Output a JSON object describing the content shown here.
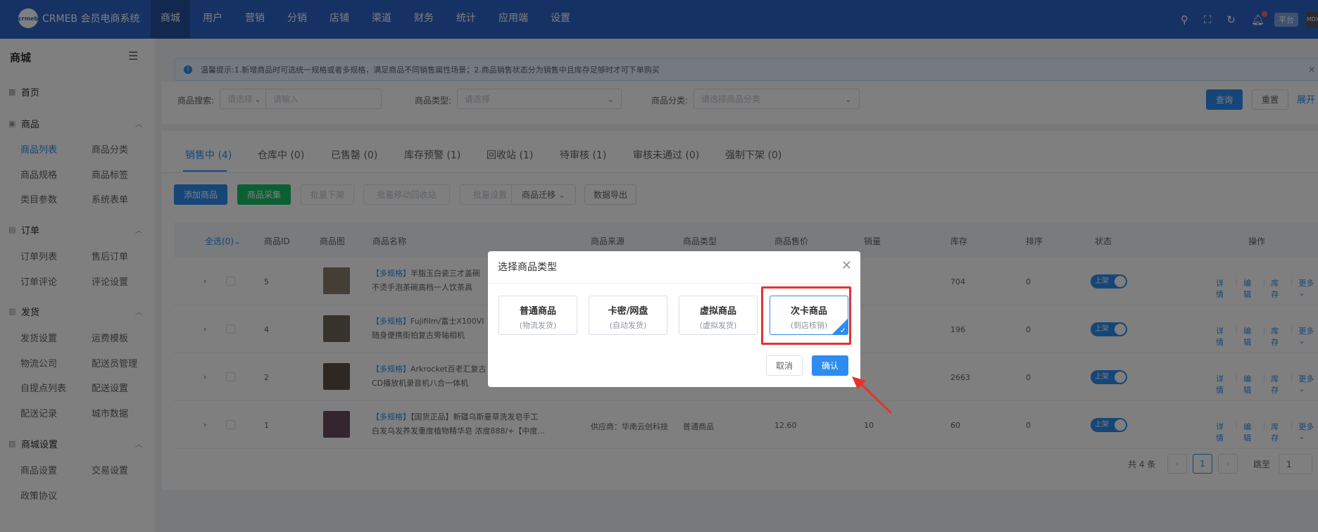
{
  "header": {
    "logo_text": "CRMEB 会员电商系统",
    "logo_mark": "crmeb",
    "nav": [
      "商城",
      "用户",
      "营销",
      "分销",
      "店铺",
      "渠道",
      "财务",
      "统计",
      "应用端",
      "设置"
    ],
    "active_nav": "商城",
    "icons": [
      "search-icon",
      "fullscreen-icon",
      "refresh-icon",
      "bell-icon"
    ],
    "platform_tag": "平台",
    "avatar_text": "MDX"
  },
  "sidebar": {
    "title": "商城",
    "groups": [
      {
        "label": "首页",
        "icon": "home-icon",
        "items": []
      },
      {
        "label": "商品",
        "icon": "goods-icon",
        "items": [
          "商品列表",
          "商品分类",
          "商品规格",
          "商品标签",
          "类目参数",
          "系统表单"
        ]
      },
      {
        "label": "订单",
        "icon": "cart-icon",
        "items": [
          "订单列表",
          "售后订单",
          "订单评论",
          "评论设置"
        ]
      },
      {
        "label": "发货",
        "icon": "truck-icon",
        "items": [
          "发货设置",
          "运费模板",
          "物流公司",
          "配送员管理",
          "自提点列表",
          "配送设置",
          "配送记录",
          "城市数据"
        ]
      },
      {
        "label": "商城设置",
        "icon": "shop-settings-icon",
        "items": [
          "商品设置",
          "交易设置",
          "政策协议"
        ]
      }
    ],
    "active_item": "商品列表"
  },
  "tip": {
    "text": "温馨提示:1.新增商品时可选统一规格或者多规格，满足商品不同销售属性场景；2.商品销售状态分为销售中且库存足够时才可下单购买"
  },
  "filters": {
    "search_label": "商品搜索:",
    "search_select_placeholder": "请选择",
    "search_input_placeholder": "请输入",
    "type_label": "商品类型:",
    "type_placeholder": "请选择",
    "category_label": "商品分类:",
    "category_placeholder": "请选择商品分类",
    "query_button": "查询",
    "reset_button": "重置",
    "expand_link": "展开"
  },
  "tabs": [
    "销售中 (4)",
    "仓库中 (0)",
    "已售罄 (0)",
    "库存预警 (1)",
    "回收站 (1)",
    "待审核 (1)",
    "审核未通过 (0)",
    "强制下架 (0)"
  ],
  "toolbar": {
    "add": "添加商品",
    "collect": "商品采集",
    "batch_off": "批量下架",
    "batch_recycle": "批量移动回收站",
    "batch_settings": "批量设置",
    "migrate": "商品迁移",
    "export": "数据导出"
  },
  "table": {
    "columns": [
      "全选(0)",
      "商品ID",
      "商品图",
      "商品名称",
      "商品来源",
      "商品类型",
      "商品售价",
      "销量",
      "库存",
      "排序",
      "状态",
      "操作"
    ],
    "rows": [
      {
        "id": "5",
        "tag": "【多规格】",
        "name_line1": "羊脂玉白瓷三才盖碗",
        "name_line2": "不烫手泡茶碗高档一人饮茶具",
        "source": "",
        "type": "",
        "price": "",
        "sales": "",
        "stock": "704",
        "sort": "0",
        "status": "上架",
        "thumb_color": "#8a7d6a"
      },
      {
        "id": "4",
        "tag": "【多规格】",
        "name_line1": "Fujifilm/富士X100VI",
        "name_line2": "随身便携街拍复古旁轴相机",
        "source": "",
        "type": "",
        "price": "",
        "sales": "",
        "stock": "196",
        "sort": "0",
        "status": "上架",
        "thumb_color": "#6d6458"
      },
      {
        "id": "2",
        "tag": "【多规格】",
        "name_line1": "Arkrocket百老汇复古",
        "name_line2": "CD播放机录音机八合一体机",
        "source": "",
        "type": "",
        "price": "",
        "sales": "",
        "stock": "2663",
        "sort": "0",
        "status": "上架",
        "thumb_color": "#5a5045"
      },
      {
        "id": "1",
        "tag": "【多规格】",
        "name_line1": "【国货正品】新疆乌斯曼草洗发皂手工",
        "name_line2": "白发乌发养发重度植物精华皂 浓度888/+【中度...",
        "source": "供应商：华南云创科技",
        "type": "普通商品",
        "price": "12.60",
        "sales": "10",
        "stock": "60",
        "sort": "0",
        "status": "上架",
        "thumb_color": "#6b4a5e"
      }
    ],
    "ops": [
      "详情",
      "编辑",
      "库存",
      "更多"
    ]
  },
  "pagination": {
    "total_text": "共 4 条",
    "current_page": "1",
    "jump_label": "跳至",
    "jump_value": "1"
  },
  "modal": {
    "title": "选择商品类型",
    "options": [
      {
        "name": "普通商品",
        "desc": "(物流发货)"
      },
      {
        "name": "卡密/网盘",
        "desc": "(自动发货)"
      },
      {
        "name": "虚拟商品",
        "desc": "(虚拟发货)"
      },
      {
        "name": "次卡商品",
        "desc": "(到店核销)"
      }
    ],
    "selected": "次卡商品",
    "cancel": "取消",
    "confirm": "确认"
  },
  "colors": {
    "primary": "#2d8cf0",
    "header_bg": "#2d64c8",
    "success": "#19be6b",
    "annotation_red": "#e7322e"
  }
}
